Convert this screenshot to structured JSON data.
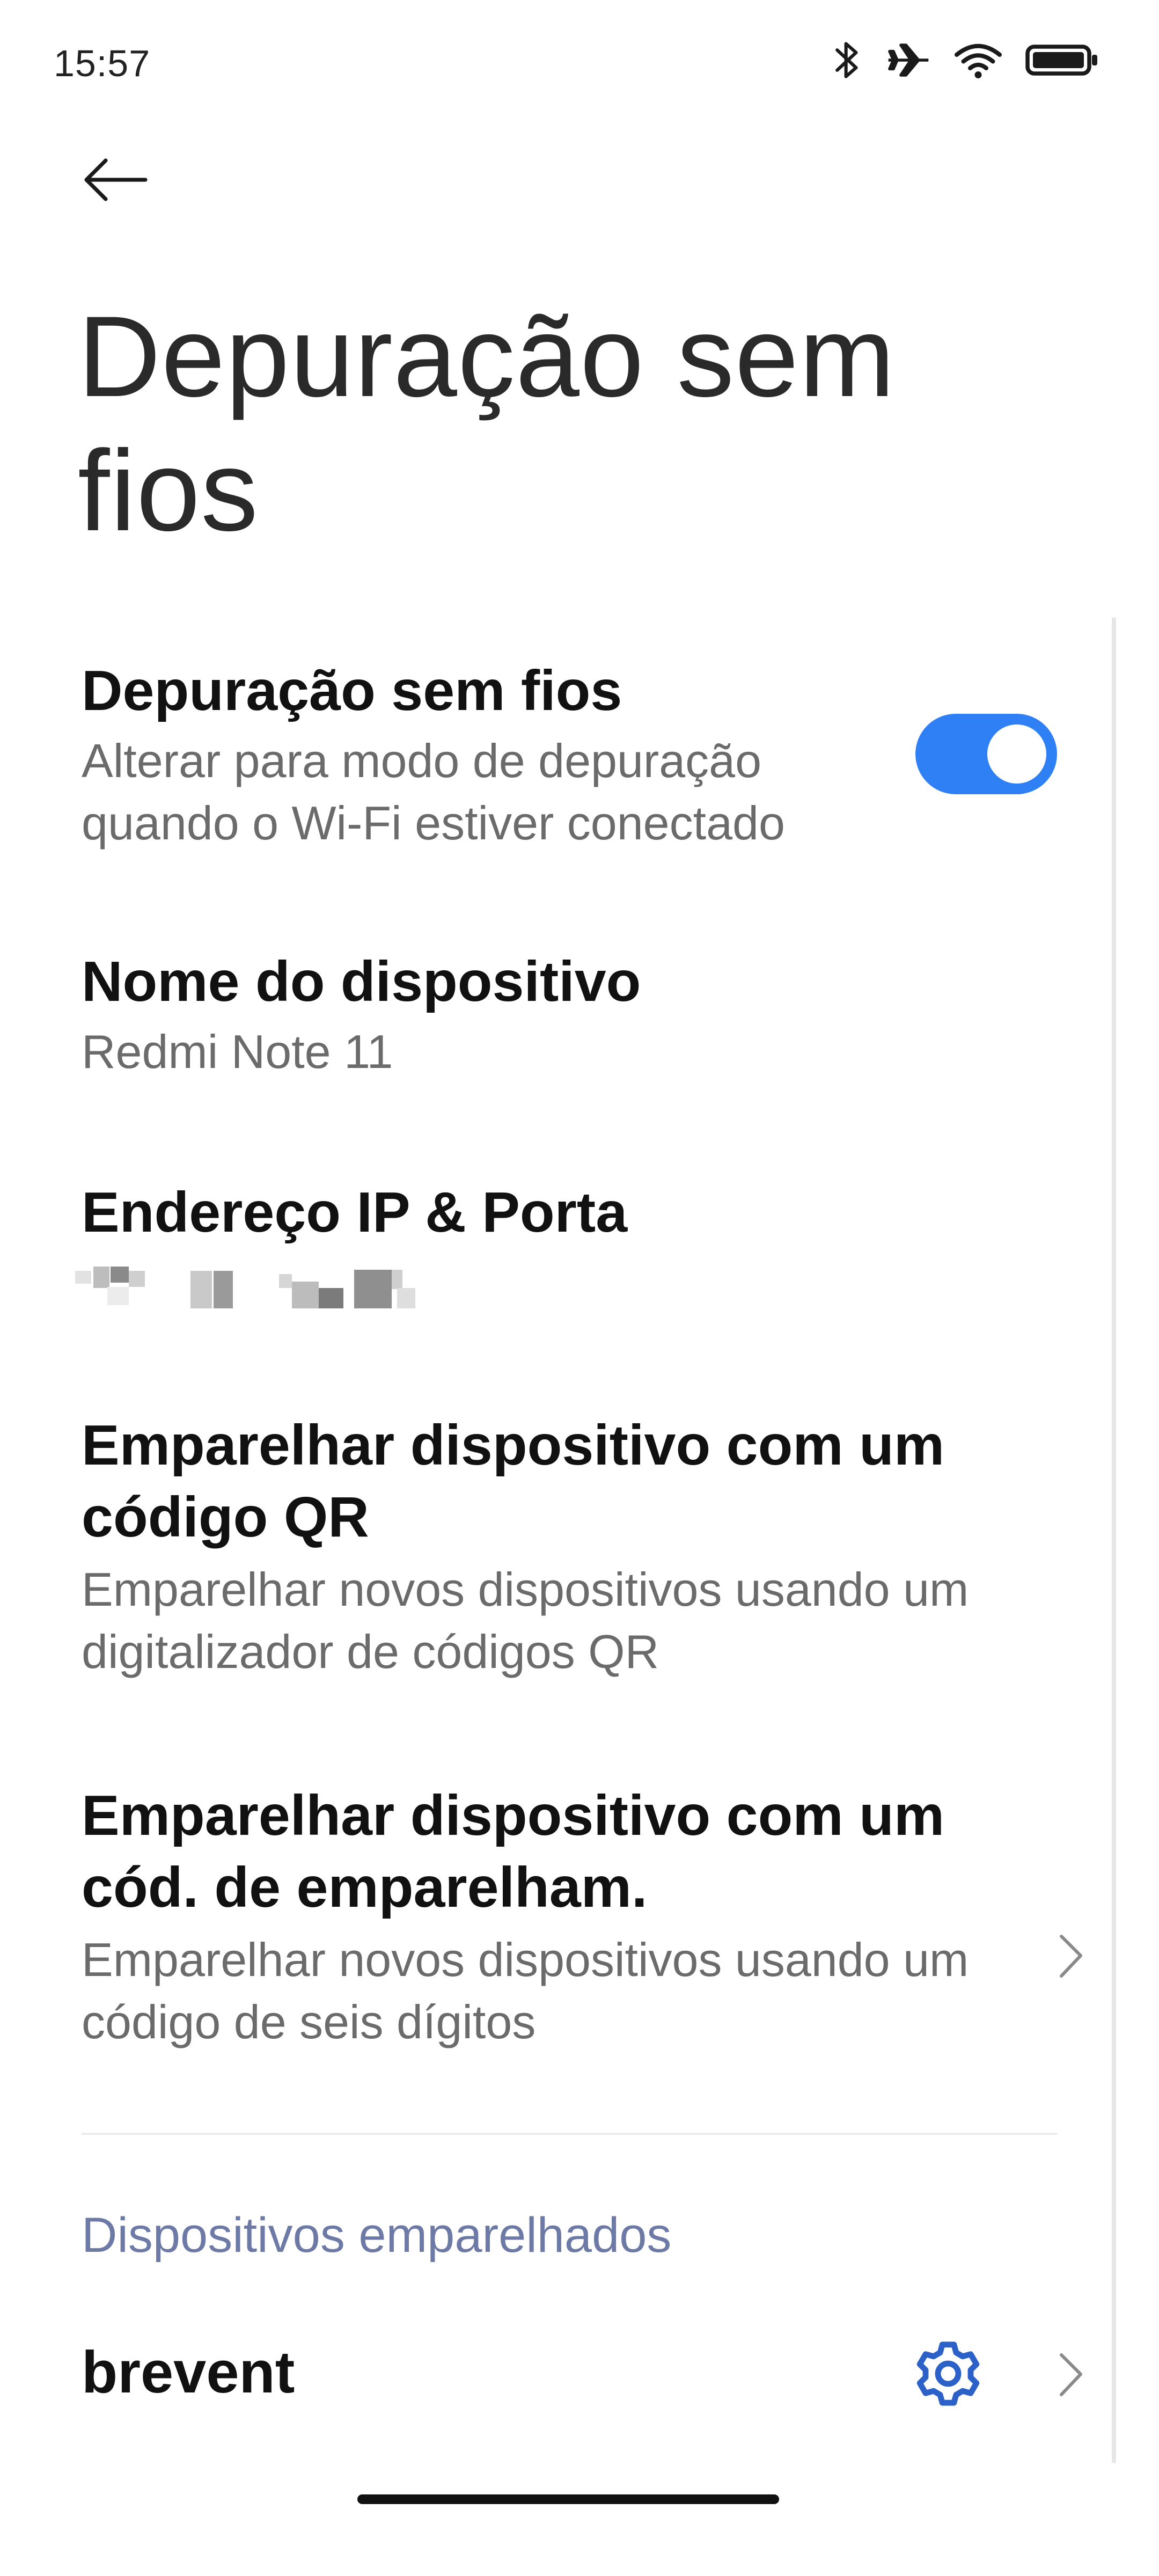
{
  "status_bar": {
    "time": "15:57",
    "icons": [
      "bluetooth-icon",
      "airplane-mode-icon",
      "wifi-icon",
      "battery-icon"
    ]
  },
  "header": {
    "back_icon": "arrow-left-icon",
    "title": "Depuração sem fios"
  },
  "settings": {
    "wireless_debugging": {
      "title": "Depuração sem fios",
      "subtitle": "Alterar para modo de depuração quando o Wi-Fi estiver conectado",
      "enabled": true
    },
    "device_name": {
      "title": "Nome do dispositivo",
      "value": "Redmi Note 11"
    },
    "ip_port": {
      "title": "Endereço IP & Porta",
      "value_redacted": true
    },
    "pair_qr": {
      "title": "Emparelhar dispositivo com um código QR",
      "subtitle": "Emparelhar novos dispositivos usando um digitalizador de códigos QR"
    },
    "pair_code": {
      "title": "Emparelhar dispositivo com um cód. de emparelham.",
      "subtitle": "Emparelhar novos dispositivos usando um código de seis dígitos",
      "chevron_icon": "chevron-right-icon"
    }
  },
  "paired_devices": {
    "header": "Dispositivos emparelhados",
    "items": [
      {
        "name": "brevent",
        "settings_icon": "gear-icon",
        "chevron_icon": "chevron-right-icon"
      }
    ]
  },
  "colors": {
    "accent": "#2f7ff5",
    "section_header": "#6e7aa6",
    "gear": "#2c62c8"
  }
}
